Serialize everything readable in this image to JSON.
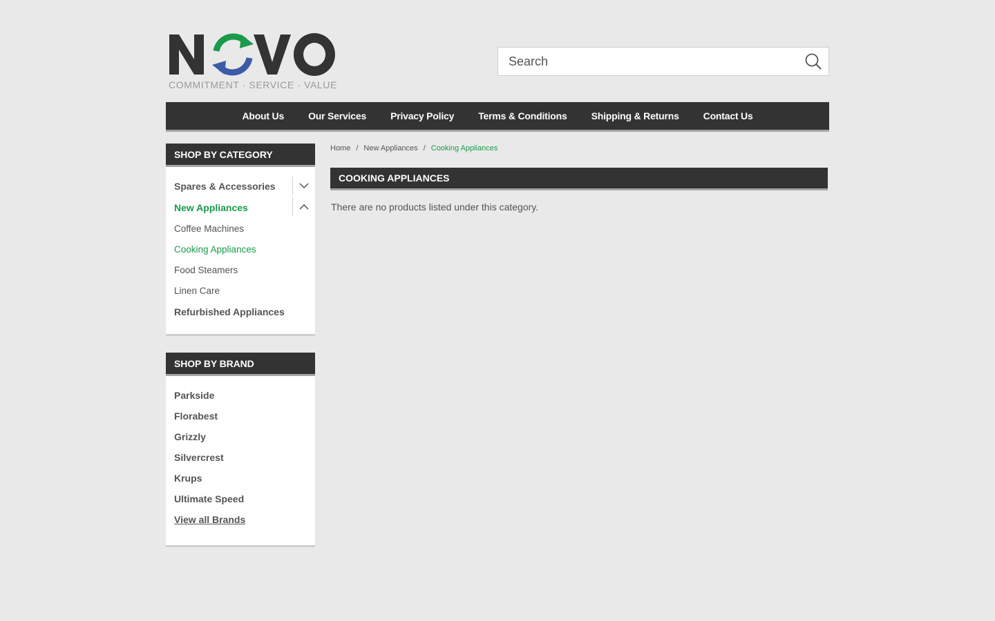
{
  "brand": {
    "logo_text": "NOVO",
    "tagline": "COMMITMENT · SERVICE · VALUE",
    "colors": {
      "green": "#1a9b4b",
      "blue": "#3b5ba6",
      "dark": "#333333"
    }
  },
  "search": {
    "placeholder": "Search",
    "icon": "search-icon"
  },
  "nav": [
    {
      "label": "About Us"
    },
    {
      "label": "Our Services"
    },
    {
      "label": "Privacy Policy"
    },
    {
      "label": "Terms & Conditions"
    },
    {
      "label": "Shipping & Returns"
    },
    {
      "label": "Contact Us"
    }
  ],
  "sidebar": {
    "categories_title": "SHOP BY CATEGORY",
    "categories": [
      {
        "label": "Spares & Accessories",
        "expanded": false,
        "icon": "chevron-down-icon"
      },
      {
        "label": "New Appliances",
        "expanded": true,
        "icon": "chevron-up-icon"
      }
    ],
    "subcategories": [
      {
        "label": "Coffee Machines"
      },
      {
        "label": "Cooking Appliances"
      },
      {
        "label": "Food Steamers"
      },
      {
        "label": "Linen Care"
      }
    ],
    "extra_category": "Refurbished Appliances",
    "brands_title": "SHOP BY BRAND",
    "brands": [
      {
        "label": "Parkside"
      },
      {
        "label": "Florabest"
      },
      {
        "label": "Grizzly"
      },
      {
        "label": "Silvercrest"
      },
      {
        "label": "Krups"
      },
      {
        "label": "Ultimate Speed"
      }
    ],
    "view_all_brands": "View all Brands"
  },
  "breadcrumb": [
    {
      "label": "Home"
    },
    {
      "label": "New Appliances"
    },
    {
      "label": "Cooking Appliances"
    }
  ],
  "breadcrumb_separator": "/",
  "main": {
    "title": "COOKING APPLIANCES",
    "empty_message": "There are no products listed under this category."
  }
}
